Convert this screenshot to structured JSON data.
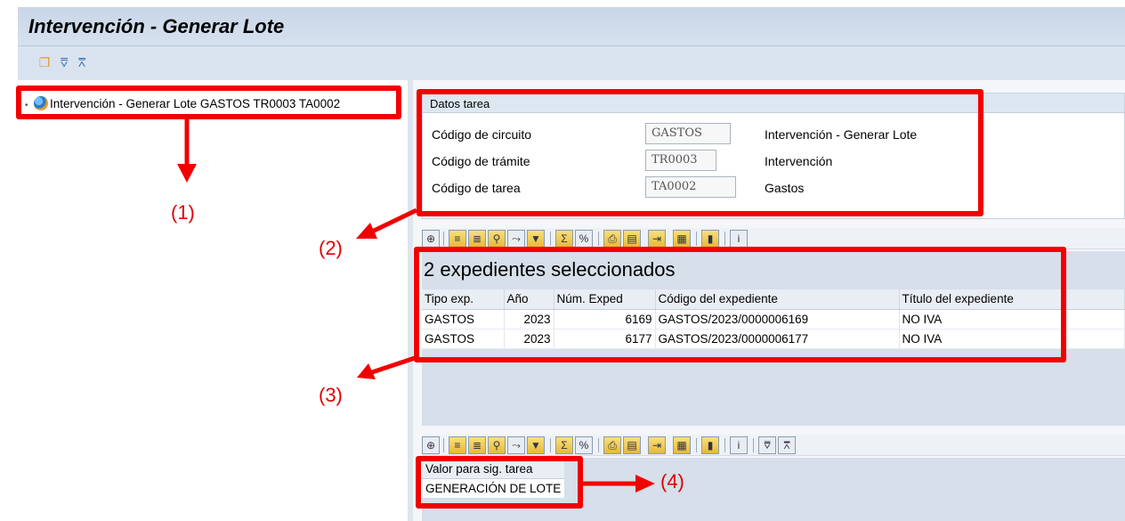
{
  "window": {
    "title": "Intervención - Generar  Lote"
  },
  "app_toolbar": {
    "icons": [
      "expand-all-icon",
      "collapse-down-icon",
      "collapse-up-icon"
    ]
  },
  "tree": {
    "node_label": "Intervención - Generar  Lote GASTOS TR0003 TA0002"
  },
  "datos_tarea": {
    "title": "Datos tarea",
    "rows": [
      {
        "label": "Código de circuito",
        "value": "GASTOS",
        "description": "Intervención - Generar  Lote"
      },
      {
        "label": "Código de trámite",
        "value": "TR0003",
        "description": "Intervención"
      },
      {
        "label": "Código de tarea",
        "value": "TA0002",
        "description": "Gastos"
      }
    ]
  },
  "expedientes": {
    "title": "2 expedientes seleccionados",
    "columns": [
      "Tipo exp.",
      "Año",
      "Núm. Exped",
      "Código del expediente",
      "Título del expediente"
    ],
    "rows": [
      [
        "GASTOS",
        "2023",
        "6169",
        "GASTOS/2023/0000006169",
        "NO IVA"
      ],
      [
        "GASTOS",
        "2023",
        "6177",
        "GASTOS/2023/0000006177",
        "NO IVA"
      ]
    ]
  },
  "valor_sig_tarea": {
    "column": "Valor para sig. tarea",
    "value": "GENERACIÓN DE LOTE"
  },
  "callouts": [
    "(1)",
    "(2)",
    "(3)",
    "(4)"
  ],
  "colors": {
    "annotation": "#f20000",
    "header_bg": "#c9d6e8"
  }
}
